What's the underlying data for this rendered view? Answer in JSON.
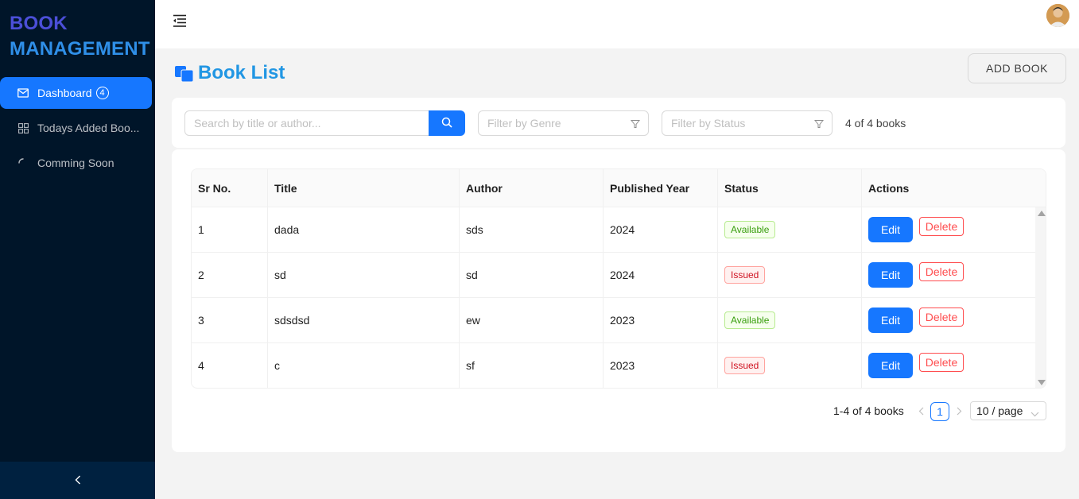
{
  "app": {
    "logo_line1": "BOOK",
    "logo_line2": "MANAGEMENT"
  },
  "sidebar": {
    "items": [
      {
        "label": "Dashboard",
        "icon": "mail-icon",
        "badge": "4",
        "active": true
      },
      {
        "label": "Todays Added Boo...",
        "icon": "appstore-icon",
        "active": false
      },
      {
        "label": "Comming Soon",
        "icon": "loading-icon",
        "active": false
      }
    ]
  },
  "page": {
    "title": "Book List",
    "add_button": "ADD BOOK"
  },
  "filters": {
    "search_placeholder": "Search by title or author...",
    "genre_placeholder": "Filter by Genre",
    "status_placeholder": "Filter by Status",
    "count_text": "4 of 4 books"
  },
  "table": {
    "columns": [
      "Sr No.",
      "Title",
      "Author",
      "Published Year",
      "Status",
      "Actions"
    ],
    "rows": [
      {
        "sr": "1",
        "title": "dada",
        "author": "sds",
        "year": "2024",
        "status": "Available"
      },
      {
        "sr": "2",
        "title": "sd",
        "author": "sd",
        "year": "2024",
        "status": "Issued"
      },
      {
        "sr": "3",
        "title": "sdsdsd",
        "author": "ew",
        "year": "2023",
        "status": "Available"
      },
      {
        "sr": "4",
        "title": "c",
        "author": "sf",
        "year": "2023",
        "status": "Issued"
      }
    ],
    "edit_label": "Edit",
    "delete_label": "Delete"
  },
  "pagination": {
    "total_text": "1-4 of 4 books",
    "current_page": "1",
    "page_size": "10 / page"
  },
  "colors": {
    "primary": "#1677ff",
    "sidebar_bg": "#001529",
    "title_color": "#2196e3",
    "available": "#389e0d",
    "issued": "#cf1322"
  }
}
